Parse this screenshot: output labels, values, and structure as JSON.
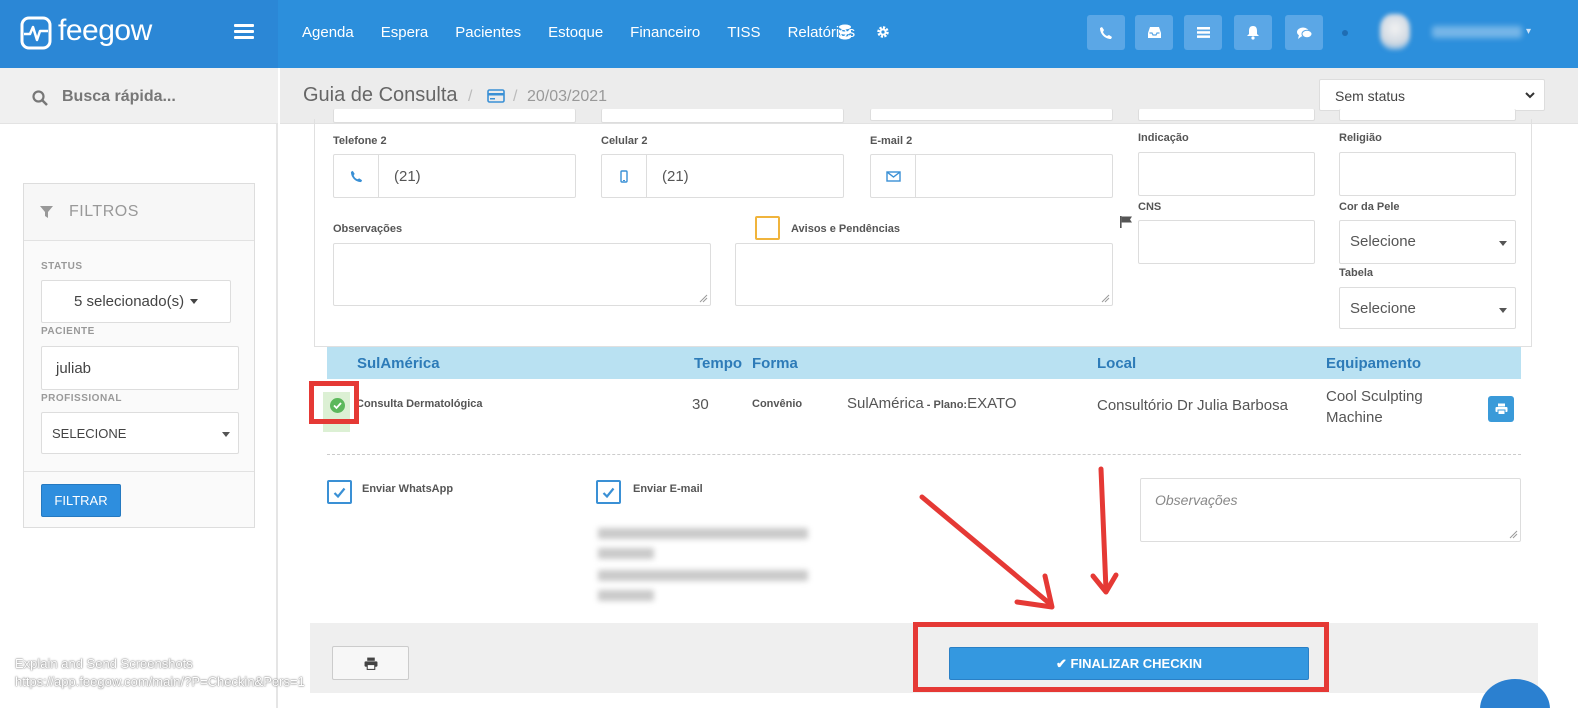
{
  "brand": {
    "name": "feegow"
  },
  "nav": {
    "items": [
      "Agenda",
      "Espera",
      "Pacientes",
      "Estoque",
      "Financeiro",
      "TISS",
      "Relatórios"
    ],
    "icons": [
      "database-icon",
      "gear-icon"
    ]
  },
  "toolbar": {
    "buttons": [
      "phone-icon",
      "inbox-icon",
      "list-icon",
      "bell-icon",
      "chat-icon"
    ],
    "button_color": "#5ba7e6"
  },
  "sidebar": {
    "search_placeholder": "Busca rápida...",
    "filters": {
      "title": "FILTROS",
      "status_label": "STATUS",
      "status_value": "5 selecionado(s)",
      "patient_label": "PACIENTE",
      "patient_value": "juliab",
      "professional_label": "PROFISSIONAL",
      "professional_value": "SELECIONE",
      "submit_label": "FILTRAR"
    }
  },
  "header": {
    "title": "Guia de Consulta",
    "date": "20/03/2021",
    "status_select": "Sem status"
  },
  "form": {
    "telefone2_label": "Telefone 2",
    "telefone2_value": "(21)",
    "celular2_label": "Celular 2",
    "celular2_value": "(21)",
    "email2_label": "E-mail 2",
    "indicacao_label": "Indicação",
    "religiao_label": "Religião",
    "cns_label": "CNS",
    "cor_pele_label": "Cor da Pele",
    "cor_pele_value": "Selecione",
    "tabela_label": "Tabela",
    "tabela_value": "Selecione",
    "observacoes_label": "Observações",
    "avisos_label": "Avisos e Pendências"
  },
  "procedures": {
    "headers": {
      "convenio": "SulAmérica",
      "tempo": "Tempo",
      "forma": "Forma",
      "local": "Local",
      "equipamento": "Equipamento"
    },
    "rows": [
      {
        "procedimento": "Consulta Dermatológica",
        "tempo": "30",
        "forma": "Convênio",
        "convenio": "SulAmérica",
        "plano_label": " - Plano:",
        "plano": "EXATO",
        "local": "Consultório Dr Julia Barbosa",
        "equipamento_line1": "Cool Sculpting",
        "equipamento_line2": "Machine"
      }
    ]
  },
  "notify": {
    "whatsapp_label": "Enviar WhatsApp",
    "email_label": "Enviar E-mail",
    "observacoes_placeholder": "Observações"
  },
  "footer": {
    "finalize_label": "FINALIZAR CHECKIN"
  },
  "overlay": {
    "line1": "Explain and Send Screenshots",
    "line2": "https://app.feegow.com/main/?P=Checkin&Pers=1"
  },
  "colors": {
    "topbar": "#2c8fdc",
    "accent": "#3498e0",
    "table_header": "#b9e1f2",
    "annotation_red": "#e53935",
    "checkbox_orange": "#f0b43c",
    "success": "#5cb85c"
  }
}
